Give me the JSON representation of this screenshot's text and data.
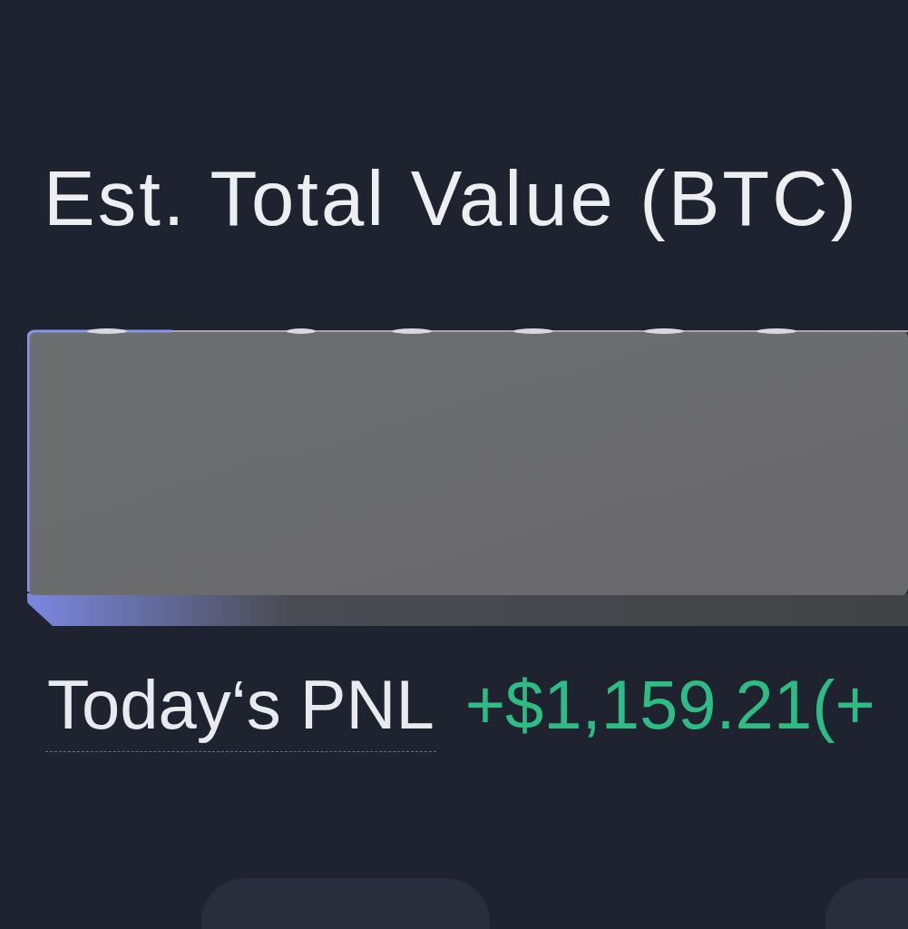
{
  "header": {
    "title": "Est. Total Value (BTC)"
  },
  "pnl": {
    "label": "Today‘s PNL",
    "value": "+$1,159.21(+",
    "positive": true
  }
}
